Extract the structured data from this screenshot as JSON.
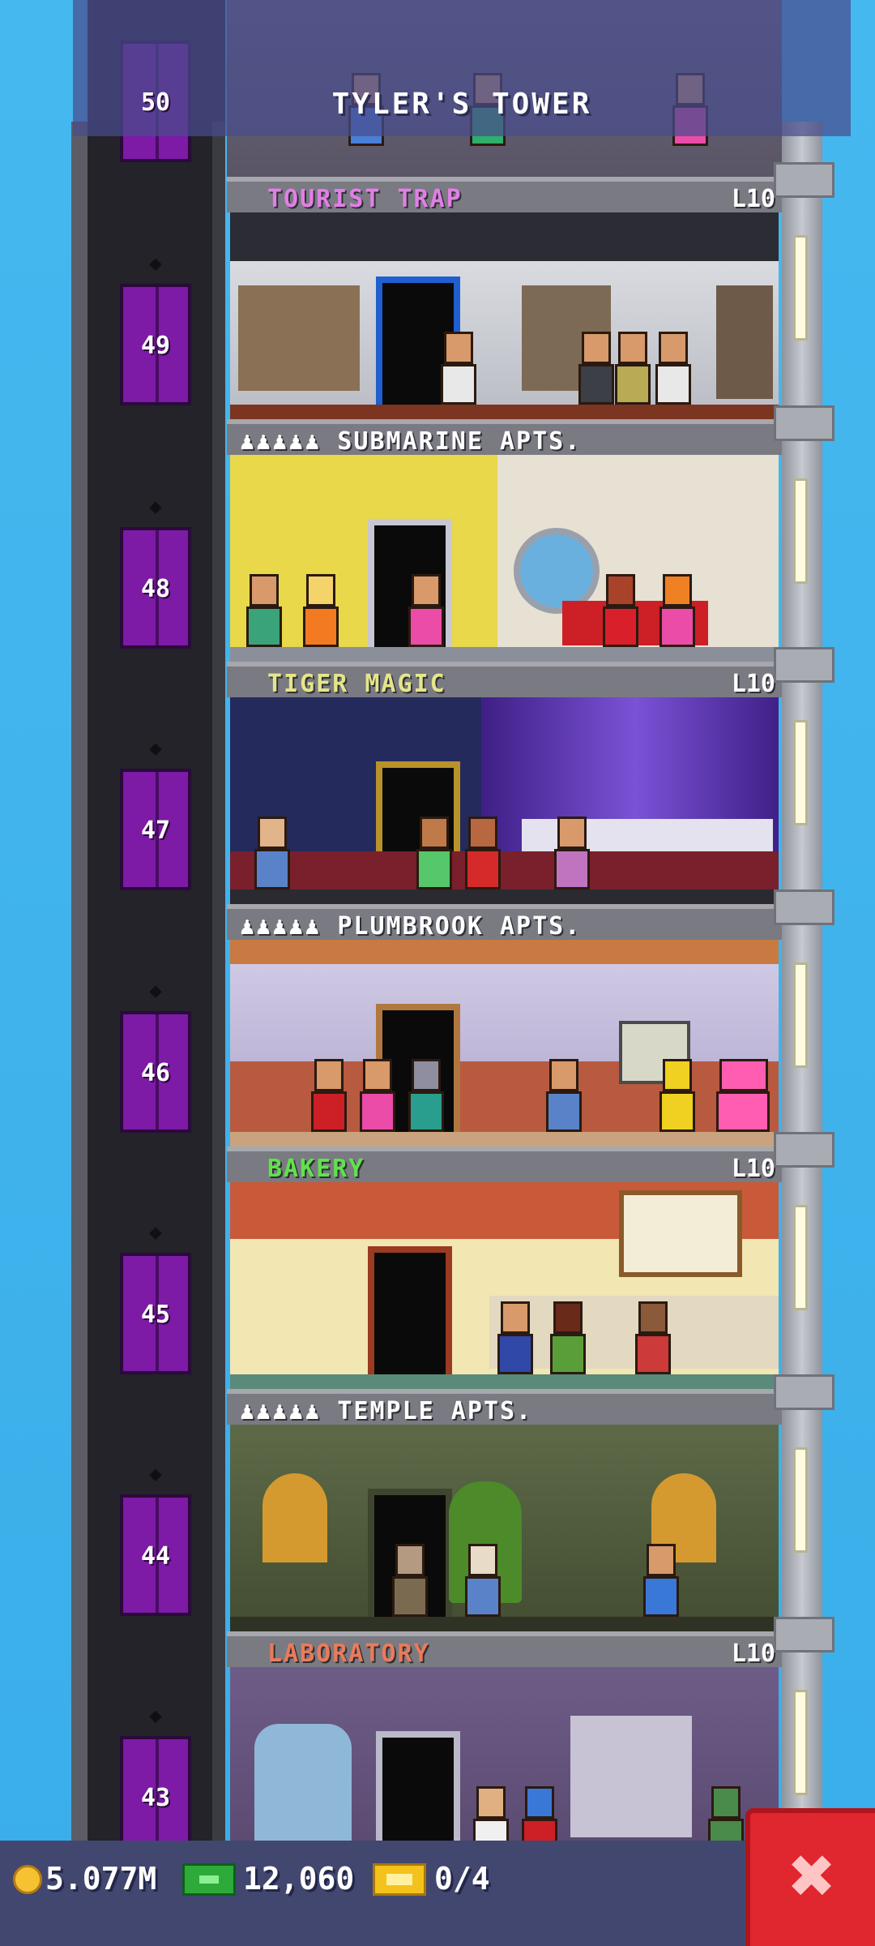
{
  "header": {
    "title": "TYLER'S TOWER"
  },
  "elevator": {
    "floor_numbers": [
      "50",
      "49",
      "48",
      "47",
      "46",
      "45",
      "44",
      "43"
    ]
  },
  "floors": [
    {
      "name": "TOURIST TRAP",
      "level": "L10",
      "type": "business",
      "name_color": "#e27fe6"
    },
    {
      "name": "SUBMARINE APTS.",
      "type": "residential",
      "residents_icon": "♟♟♟♟♟"
    },
    {
      "name": "TIGER MAGIC",
      "level": "L10",
      "type": "business",
      "name_color": "#e5e58a"
    },
    {
      "name": "PLUMBROOK APTS.",
      "type": "residential",
      "residents_icon": "♟♟♟♟♟"
    },
    {
      "name": "BAKERY",
      "level": "L10",
      "type": "business",
      "name_color": "#5fe34a"
    },
    {
      "name": "TEMPLE APTS.",
      "type": "residential",
      "residents_icon": "♟♟♟♟♟"
    },
    {
      "name": "LABORATORY",
      "level": "L10",
      "type": "business",
      "name_color": "#ea7b5a"
    }
  ],
  "status_bar": {
    "coins": "5.077M",
    "bux": "12,060",
    "tickets": "0/4",
    "icons": {
      "coins": "coin-icon",
      "bux": "bux-icon",
      "tickets": "ticket-icon"
    }
  },
  "close_button": {
    "label": "✖"
  },
  "colors": {
    "sky": "#3fb2ee",
    "elevator": "#7d1aa6",
    "status_bar": "#424770",
    "close": "#e0262e"
  }
}
